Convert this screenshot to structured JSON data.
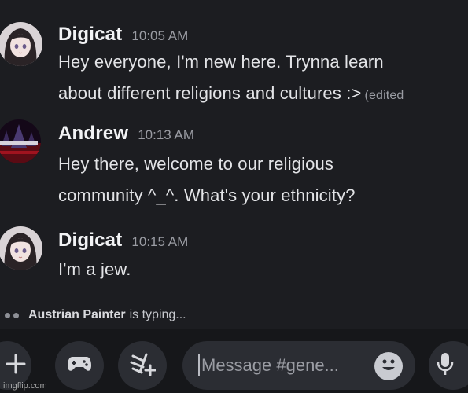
{
  "messages": [
    {
      "author": "Digicat",
      "time": "10:05 AM",
      "lines": [
        "Hey everyone, I'm new here. Trynna learn",
        "about different religions and cultures :>"
      ],
      "edited": "(edited"
    },
    {
      "author": "Andrew",
      "time": "10:13 AM",
      "lines": [
        "Hey there, welcome to our religious",
        "community ^_^. What's your ethnicity?"
      ]
    },
    {
      "author": "Digicat",
      "time": "10:15 AM",
      "lines": [
        "I'm a jew."
      ]
    }
  ],
  "typing": {
    "user": "Austrian Painter",
    "suffix": "is typing..."
  },
  "composer": {
    "placeholder": "Message #gene..."
  },
  "watermark": "imgflip.com",
  "colors": {
    "background": "#1c1d21",
    "composer_bar": "#16171a",
    "button": "#2b2d33",
    "muted_text": "#9a9ca3"
  },
  "icons": [
    "plus-icon",
    "gamepad-icon",
    "gift-sparkle-icon",
    "emoji-icon",
    "microphone-icon"
  ]
}
